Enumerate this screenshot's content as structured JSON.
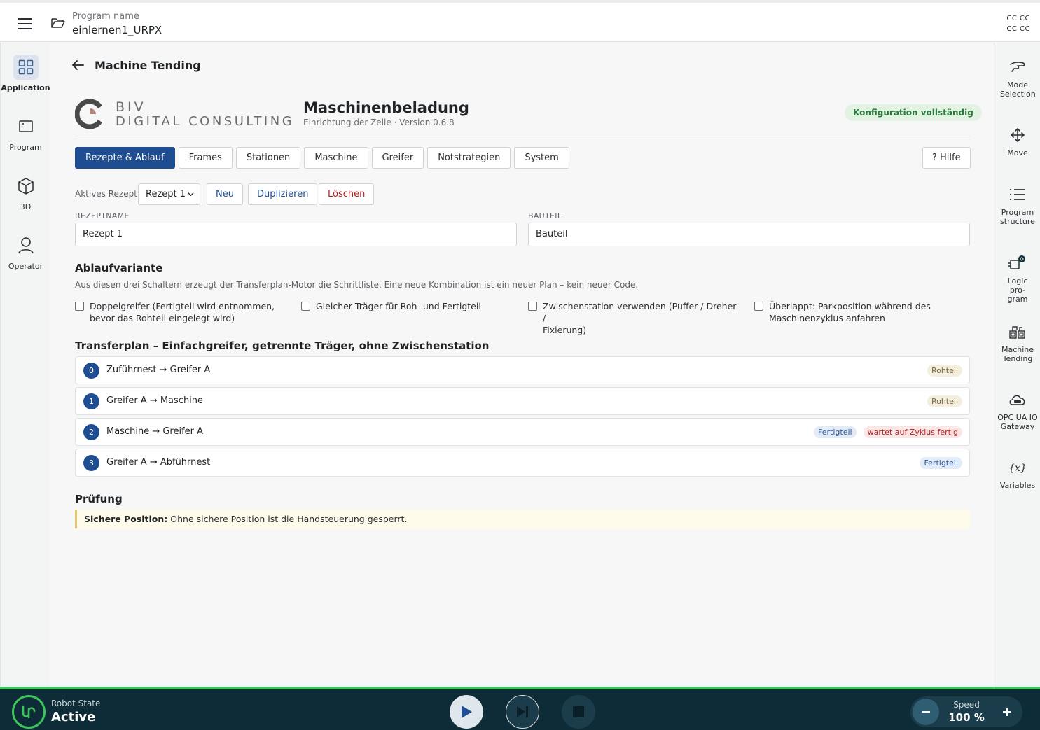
{
  "header": {
    "program_label": "Program name",
    "program_name": "einlernen1_URPX",
    "corner_lines": [
      "CC CC",
      "CC CC"
    ]
  },
  "left_nav": {
    "items": [
      {
        "label": "Application",
        "icon": "grid-icon",
        "active": true
      },
      {
        "label": "Program",
        "icon": "window-icon"
      },
      {
        "label": "3D",
        "icon": "cube-icon"
      },
      {
        "label": "Operator",
        "icon": "user-icon"
      }
    ]
  },
  "right_nav": {
    "items": [
      {
        "label": "Mode Selection",
        "icon": "hand-icon"
      },
      {
        "label": "Move",
        "icon": "move-icon"
      },
      {
        "label": "Program structure",
        "icon": "list-icon"
      },
      {
        "label": "Logic pro- gram",
        "icon": "logic-icon"
      },
      {
        "label": "Machine Tending",
        "icon": "machine-icon"
      },
      {
        "label": "OPC UA IO Gateway",
        "icon": "cloud-icon"
      },
      {
        "label": "Variables",
        "icon": "variables-icon"
      }
    ]
  },
  "page": {
    "title": "Machine Tending",
    "logo_line1": "BIV",
    "logo_line2": "DIGITAL CONSULTING",
    "app_title": "Maschinenbeladung",
    "app_subtitle": "Einrichtung der Zelle · Version 0.6.8",
    "status": "Konfiguration vollständig"
  },
  "tabs": [
    {
      "label": "Rezepte & Ablauf",
      "active": true
    },
    {
      "label": "Frames"
    },
    {
      "label": "Stationen"
    },
    {
      "label": "Maschine"
    },
    {
      "label": "Greifer"
    },
    {
      "label": "Notstrategien"
    },
    {
      "label": "System"
    }
  ],
  "help_label": "? Hilfe",
  "recipe": {
    "label": "Aktives Rezept",
    "selected": "Rezept 1",
    "new_label": "Neu",
    "duplicate_label": "Duplizieren",
    "delete_label": "Löschen"
  },
  "fields": {
    "recipe_name_label": "REZEPTNAME",
    "recipe_name_value": "Rezept 1",
    "part_label": "BAUTEIL",
    "part_value": "Bauteil"
  },
  "variant": {
    "title": "Ablaufvariante",
    "description": "Aus diesen drei Schaltern erzeugt der Transferplan-Motor die Schrittliste. Eine neue Kombination ist ein neuer Plan – kein neuer Code.",
    "options": [
      {
        "line1": "Doppelgreifer (Fertigteil wird entnommen,",
        "line2": "bevor das Rohteil eingelegt wird)"
      },
      {
        "line1": "Gleicher Träger für Roh- und Fertigteil",
        "line2": ""
      },
      {
        "line1": "Zwischenstation verwenden (Puffer / Dreher /",
        "line2": "Fixierung)"
      },
      {
        "line1": "Überlappt: Parkposition während des",
        "line2": "Maschinenzyklus anfahren"
      }
    ]
  },
  "plan": {
    "title": "Transferplan – Einfachgreifer, getrennte Träger, ohne Zwischenstation",
    "steps": [
      {
        "num": "0",
        "text": "Zuführnest → Greifer A",
        "tags": [
          {
            "text": "Rohteil",
            "kind": "roh"
          }
        ]
      },
      {
        "num": "1",
        "text": "Greifer A → Maschine",
        "tags": [
          {
            "text": "Rohteil",
            "kind": "roh"
          }
        ]
      },
      {
        "num": "2",
        "text": "Maschine → Greifer A",
        "tags": [
          {
            "text": "Fertigteil",
            "kind": "fert"
          },
          {
            "text": "wartet auf Zyklus fertig",
            "kind": "wait"
          }
        ]
      },
      {
        "num": "3",
        "text": "Greifer A → Abführnest",
        "tags": [
          {
            "text": "Fertigteil",
            "kind": "fert"
          }
        ]
      }
    ]
  },
  "check": {
    "title": "Prüfung",
    "note_bold": "Sichere Position:",
    "note_text": " Ohne sichere Position ist die Handsteuerung gesperrt."
  },
  "footer": {
    "robot_state_label": "Robot State",
    "robot_state_value": "Active",
    "speed_label": "Speed",
    "speed_value": "100 %"
  },
  "colors": {
    "accent": "#1f4d92",
    "status_green": "#3cc55a",
    "footer_bg": "#0e2c38"
  }
}
